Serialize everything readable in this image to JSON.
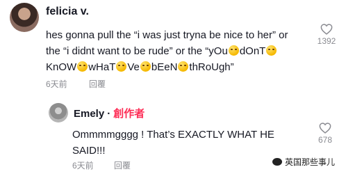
{
  "comments": [
    {
      "username": "felicia v.",
      "text_line1": "hes gonna pull the “i was just tryna be nice to her” or",
      "text_line2_a": "the “i didnt want to be rude” or the “yOu",
      "text_line2_b": "dOnT",
      "text_line3_a": "KnOW",
      "text_line3_b": "wHaT",
      "text_line3_c": "Ve",
      "text_line3_d": "bEeN",
      "text_line3_e": "thRoUgh”",
      "time": "6天前",
      "reply_label": "回覆",
      "likes": "1392",
      "icon": "heart-outline-icon"
    }
  ],
  "reply": {
    "username": "Emely",
    "separator": "·",
    "badge": "創作者",
    "text_line1": "Ommmmgggg ! That’s EXACTLY WHAT HE",
    "text_line2": "SAID!!!",
    "time": "6天前",
    "reply_label": "回覆",
    "likes": "678",
    "icon": "heart-outline-icon"
  },
  "watermark": {
    "text": "英国那些事儿",
    "icon": "wechat-icon"
  },
  "colors": {
    "creator_badge": "#fe2c55",
    "meta_gray": "#8a8b91"
  }
}
